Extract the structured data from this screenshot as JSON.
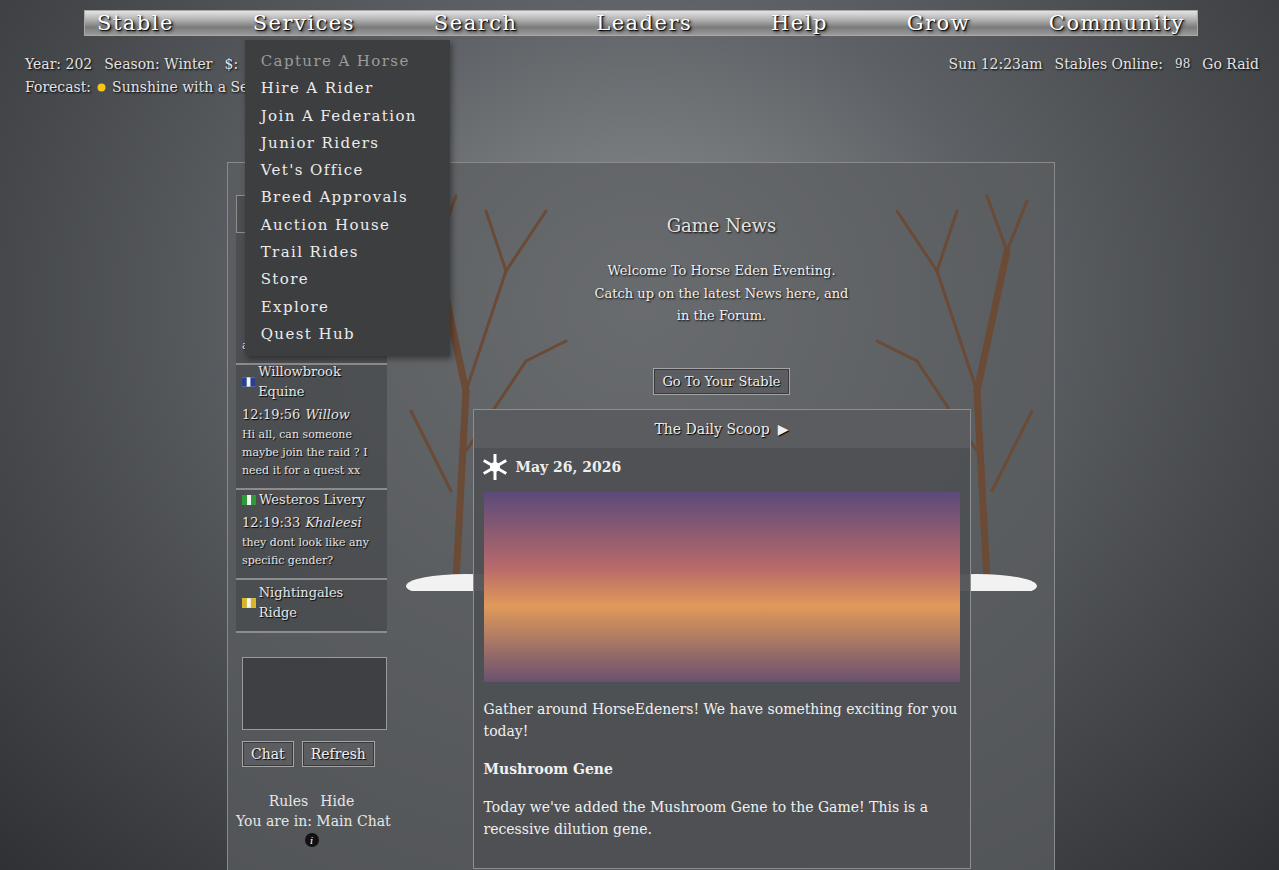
{
  "nav": {
    "items": [
      {
        "label": "Stable",
        "open": false
      },
      {
        "label": "Services",
        "open": true
      },
      {
        "label": "Search",
        "open": false
      },
      {
        "label": "Leaders",
        "open": false
      },
      {
        "label": "Help",
        "open": false
      },
      {
        "label": "Grow",
        "open": false
      },
      {
        "label": "Community",
        "open": false
      }
    ]
  },
  "services_menu": {
    "items": [
      {
        "label": "Capture A Horse",
        "dimmed": true
      },
      {
        "label": "Hire A Rider",
        "dimmed": false
      },
      {
        "label": "Join A Federation",
        "dimmed": false
      },
      {
        "label": "Junior Riders",
        "dimmed": false
      },
      {
        "label": "Vet's Office",
        "dimmed": false
      },
      {
        "label": "Breed Approvals",
        "dimmed": false
      },
      {
        "label": "Auction House",
        "dimmed": false
      },
      {
        "label": "Trail Rides",
        "dimmed": false
      },
      {
        "label": "Store",
        "dimmed": false
      },
      {
        "label": "Explore",
        "dimmed": false
      },
      {
        "label": "Quest Hub",
        "dimmed": false
      }
    ]
  },
  "status": {
    "year": "Year: 202",
    "season": "Season: Winter",
    "money": "$:",
    "time": "Sun 12:23am",
    "online_label": "Stables Online:",
    "online_count": "98",
    "raid": "Go Raid"
  },
  "forecast": {
    "label": "Forecast:",
    "text": "Sunshine with a Se"
  },
  "chat": {
    "messages": [
      {
        "stable": "",
        "time": "",
        "name": "",
        "text": "a colt.",
        "color": "#3355aa"
      },
      {
        "stable": "Willowbrook Equine",
        "time": "12:19:56",
        "name": "Willow",
        "text": "Hi all, can someone maybe join the raid ? I need it for a quest xx",
        "color": "#2a3f8f"
      },
      {
        "stable": "Westeros Livery",
        "time": "12:19:33",
        "name": "Khaleesi",
        "text": "they dont look like any specific gender?",
        "color": "#2f9a3a"
      },
      {
        "stable": "Nightingales Ridge",
        "time": "",
        "name": "",
        "text": "",
        "color": "#d9b526"
      }
    ],
    "buttons": [
      "Chat",
      "Refresh"
    ],
    "links": [
      "Rules",
      "Hide"
    ],
    "room": "You are in: Main Chat",
    "info": "i"
  },
  "news": {
    "title": "Game News",
    "intro": "Welcome To Horse Eden Eventing. Catch up on the latest News here, and in the Forum.",
    "button": "Go To Your Stable",
    "scoop": {
      "title": "The Daily Scoop",
      "arrow": "▶",
      "date": "May 26, 2026",
      "paragraphs": [
        {
          "text": "Gather around HorseEdeners! We have something exciting for you today!",
          "bold": false
        },
        {
          "text": "Mushroom Gene",
          "bold": true
        },
        {
          "text": "Today we've added the Mushroom Gene to the Game! This is a recessive dilution gene.",
          "bold": false
        }
      ]
    }
  }
}
